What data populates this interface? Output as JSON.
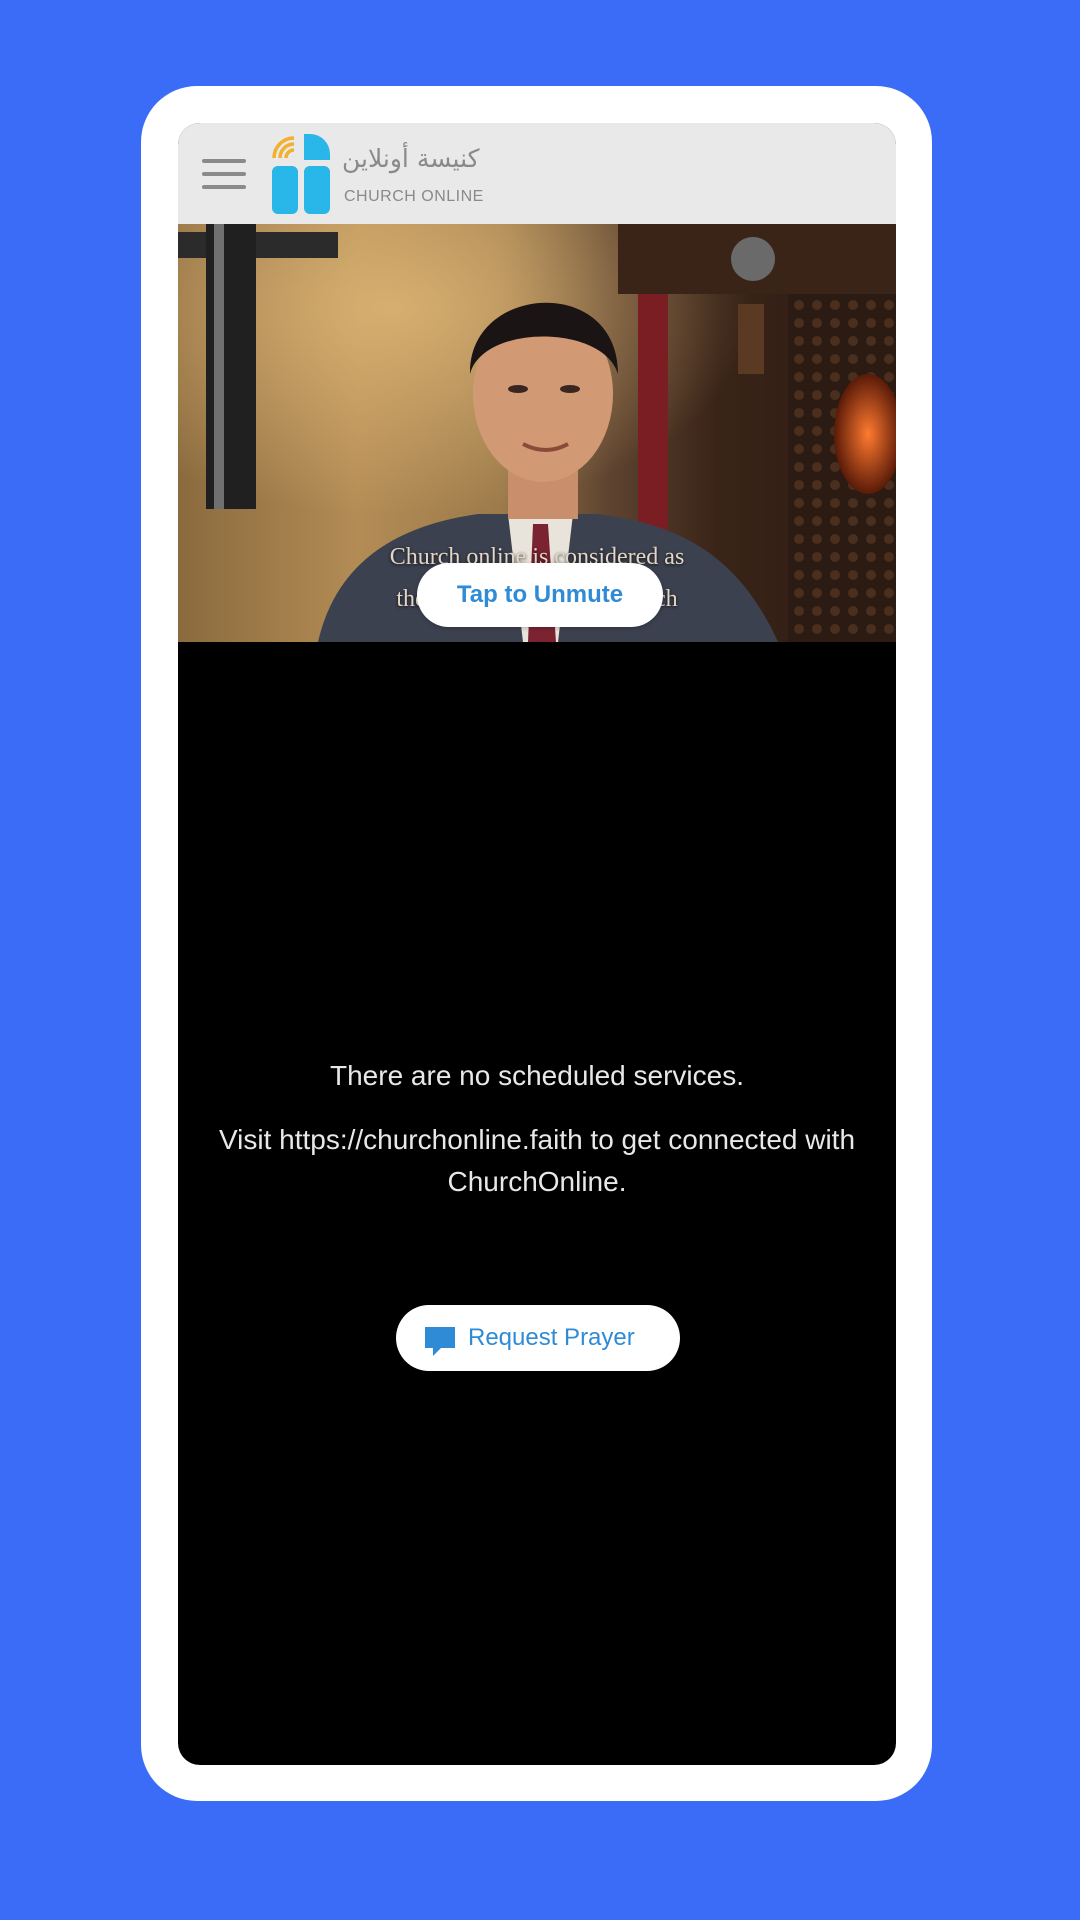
{
  "header": {
    "logo_arabic": "كنيسة أونلاين",
    "logo_english": "CHURCH ONLINE"
  },
  "video": {
    "caption_line_1": "Church online is considered as",
    "caption_line_2": "the first Arabic online church",
    "unmute_label": "Tap to Unmute"
  },
  "message": {
    "primary": "There are no scheduled services.",
    "secondary": "Visit https://churchonline.faith to get connected with ChurchOnline."
  },
  "prayer": {
    "label": "Request Prayer",
    "icon": "chat-bubble-icon"
  },
  "colors": {
    "background": "#3b6cf8",
    "accent": "#2f8bd6",
    "logo_blue": "#29b6e8",
    "logo_yellow": "#f2b02c"
  }
}
